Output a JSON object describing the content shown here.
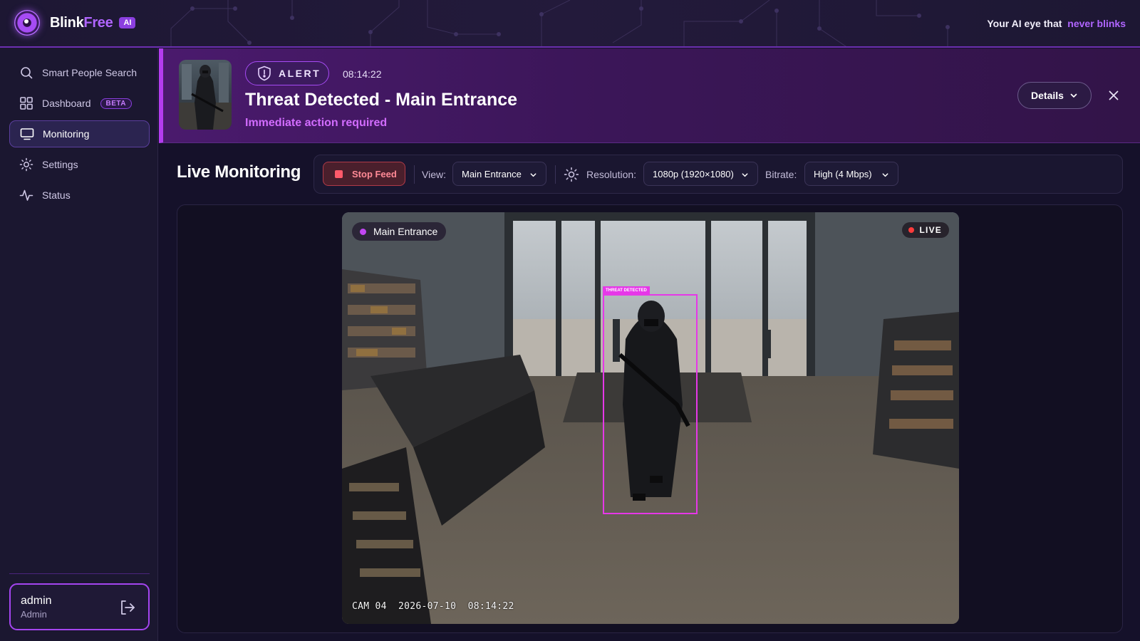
{
  "brand": {
    "name_part1": "Blink",
    "name_part2": "Free",
    "badge": "AI"
  },
  "tagline": {
    "text": "Your AI eye that",
    "highlight": "never blinks"
  },
  "sidebar": {
    "items": [
      {
        "label": "Smart People Search",
        "icon": "search-icon"
      },
      {
        "label": "Dashboard",
        "icon": "grid-icon",
        "badge": "BETA"
      },
      {
        "label": "Monitoring",
        "icon": "monitor-icon",
        "active": true
      },
      {
        "label": "Settings",
        "icon": "settings-sun-icon"
      },
      {
        "label": "Status",
        "icon": "activity-icon"
      }
    ],
    "user": {
      "name": "admin",
      "role": "Admin",
      "action_icon": "logout-icon"
    }
  },
  "alert": {
    "pill": "ALERT",
    "time": "08:14:22",
    "title": "Threat Detected - Main Entrance",
    "subtitle": "Immediate action required",
    "details_label": "Details",
    "accent": "#b43cf0"
  },
  "monitoring": {
    "title": "Live Monitoring",
    "stop_label": "Stop Feed",
    "view_label": "View:",
    "view_value": "Main Entrance",
    "resolution_label": "Resolution:",
    "resolution_value": "1080p (1920×1080)",
    "bitrate_label": "Bitrate:",
    "bitrate_value": "High (4 Mbps)"
  },
  "feed": {
    "camera_name": "Main Entrance",
    "live_label": "LIVE",
    "detection_label": "THREAT DETECTED",
    "osd_camera": "CAM 04",
    "osd_date": "2026-07-10",
    "osd_time": "08:14:22"
  }
}
